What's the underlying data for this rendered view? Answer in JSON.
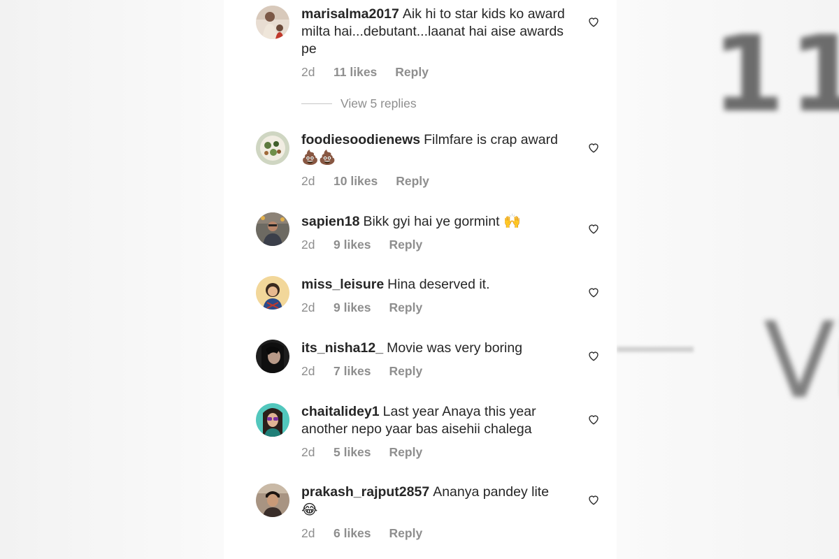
{
  "background": {
    "right_number": "11",
    "right_text": "Vi"
  },
  "comments": [
    {
      "username": "marisalma2017",
      "text": "Aik hi to star kids ko award milta hai...debutant...laanat hai aise awards pe",
      "emoji": "",
      "time": "2d",
      "likes": "11 likes",
      "reply": "Reply",
      "avatar_color": "#c9b8a8"
    },
    {
      "username": "foodiesoodienews",
      "text": "Filmfare is crap award",
      "emoji": "💩💩",
      "time": "2d",
      "likes": "10 likes",
      "reply": "Reply",
      "avatar_color": "#7a8f6a"
    },
    {
      "username": "sapien18",
      "text": "Bikk gyi hai ye gormint",
      "emoji": "🙌",
      "time": "2d",
      "likes": "9 likes",
      "reply": "Reply",
      "avatar_color": "#6b6560"
    },
    {
      "username": "miss_leisure",
      "text": "Hina deserved it.",
      "emoji": "",
      "time": "2d",
      "likes": "9 likes",
      "reply": "Reply",
      "avatar_color": "#e4c08a"
    },
    {
      "username": "its_nisha12_",
      "text": "Movie was very boring",
      "emoji": "",
      "time": "2d",
      "likes": "7 likes",
      "reply": "Reply",
      "avatar_color": "#2e2e2e"
    },
    {
      "username": "chaitalidey1",
      "text": "Last year Anaya this year another nepo yaar bas aisehii chalega",
      "emoji": "",
      "time": "2d",
      "likes": "5 likes",
      "reply": "Reply",
      "avatar_color": "#3aa7a0"
    },
    {
      "username": "prakash_rajput2857",
      "text": "Ananya pandey lite",
      "emoji": "😂",
      "time": "2d",
      "likes": "6 likes",
      "reply": "Reply",
      "avatar_color": "#8a6e5c"
    }
  ],
  "view_replies": "View 5 replies",
  "icons": {
    "like": "heart-outline-icon"
  },
  "colors": {
    "text": "#262626",
    "secondary": "#8e8e8e"
  }
}
